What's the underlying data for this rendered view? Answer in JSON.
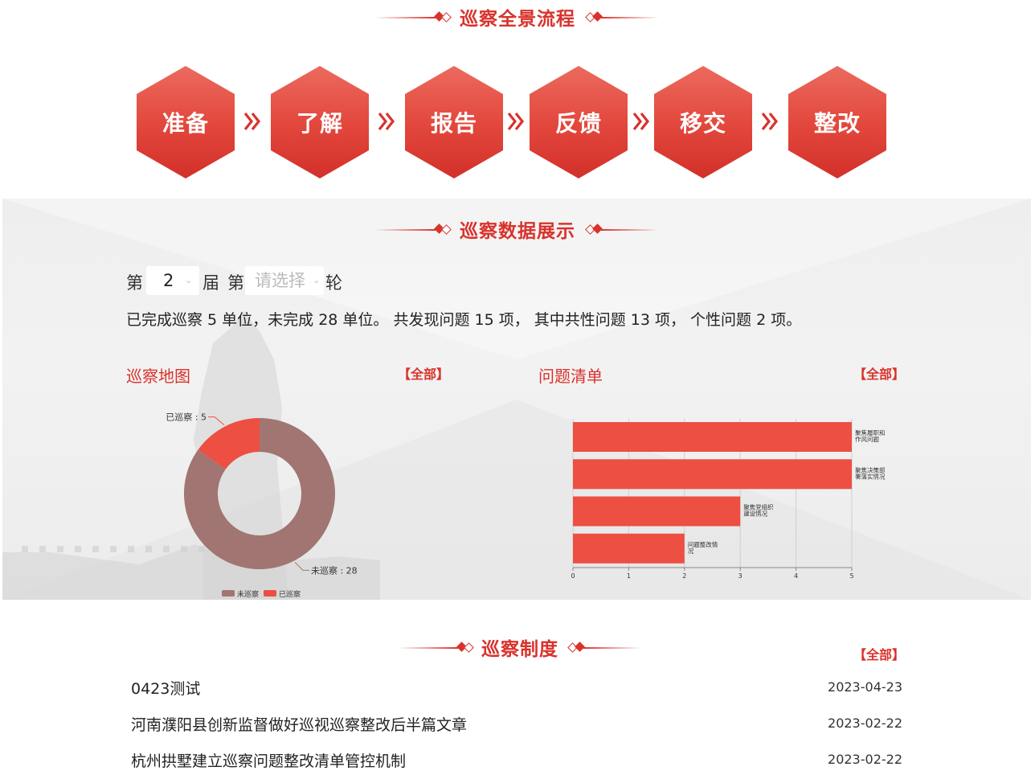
{
  "process_section": {
    "title": "巡察全景流程",
    "steps": [
      "准备",
      "了解",
      "报告",
      "反馈",
      "移交",
      "整改"
    ]
  },
  "data_section": {
    "title": "巡察数据展示",
    "filter": {
      "prefix": "第",
      "session_value": "2",
      "session_suffix": "届",
      "round_prefix": "第",
      "round_placeholder": "请选择",
      "round_suffix": "轮"
    },
    "summary": "已完成巡察 5 单位，未完成 28 单位。 共发现问题 15 项， 其中共性问题 13 项， 个性问题 2 项。",
    "map_panel": {
      "title": "巡察地图",
      "all_label": "【全部】"
    },
    "issues_panel": {
      "title": "问题清单",
      "all_label": "【全部】"
    }
  },
  "policy_section": {
    "title": "巡察制度",
    "all_label": "【全部】",
    "items": [
      {
        "title": "0423测试",
        "date": "2023-04-23"
      },
      {
        "title": "河南濮阳县创新监督做好巡视巡察整改后半篇文章",
        "date": "2023-02-22"
      },
      {
        "title": "杭州拱墅建立巡察问题整改清单管控机制",
        "date": "2023-02-22"
      }
    ]
  },
  "colors": {
    "accent": "#d9322c",
    "bar": "#ed4f43",
    "donut_not": "#a17571",
    "donut_done": "#ed4f43"
  },
  "chart_data": [
    {
      "type": "pie",
      "variant": "donut",
      "slices": [
        {
          "name": "未巡察",
          "value": 28,
          "label": "未巡察 : 28",
          "color": "#a17571"
        },
        {
          "name": "已巡察",
          "value": 5,
          "label": "已巡察 : 5",
          "color": "#ed4f43"
        }
      ],
      "legend": [
        "未巡察",
        "已巡察"
      ],
      "legend_position": "bottom"
    },
    {
      "type": "bar",
      "orientation": "horizontal",
      "categories": [
        "聚焦履职和作风问题",
        "聚焦决策部署落实情况",
        "聚焦党组织建设情况",
        "问题整改情况"
      ],
      "category_lines": [
        [
          "聚焦履职和",
          "作风问题"
        ],
        [
          "聚焦决策部",
          "署落实情况"
        ],
        [
          "聚焦党组织",
          "建设情况"
        ],
        [
          "问题整改情",
          "况"
        ]
      ],
      "values": [
        5,
        5,
        3,
        2
      ],
      "xlim": [
        0,
        5
      ],
      "xticks": [
        0,
        1,
        2,
        3,
        4,
        5
      ],
      "grid": true,
      "color": "#ed4f43"
    }
  ]
}
